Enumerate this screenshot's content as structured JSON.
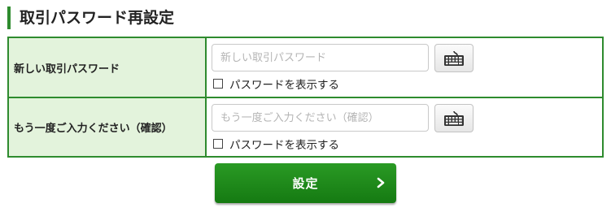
{
  "page": {
    "title": "取引パスワード再設定"
  },
  "form": {
    "rows": [
      {
        "label": "新しい取引パスワード",
        "placeholder": "新しい取引パスワード",
        "value": "",
        "keyboard_icon": "software-keyboard-icon",
        "show_password_label": "パスワードを表示する",
        "show_password_checked": false
      },
      {
        "label": "もう一度ご入力ください（確認）",
        "placeholder": "もう一度ご入力ください（確認）",
        "value": "",
        "keyboard_icon": "software-keyboard-icon",
        "show_password_label": "パスワードを表示する",
        "show_password_checked": false
      }
    ]
  },
  "submit": {
    "label": "設定",
    "icon": "chevron-right-icon"
  },
  "colors": {
    "accent": "#2e8b2e",
    "label_background": "#e3f3dc",
    "button": "#1e8a1b"
  }
}
